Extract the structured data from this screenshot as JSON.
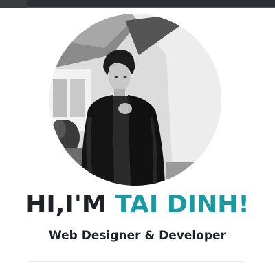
{
  "hero": {
    "greeting": "HI,I'M",
    "name": "TAI DINH!",
    "subtitle": "Web Designer & Developer"
  },
  "colors": {
    "accent": "#1a9aa0",
    "text": "#1e2226",
    "top_bar": "#2d2f33"
  },
  "icons": {
    "avatar": "profile-photo"
  }
}
